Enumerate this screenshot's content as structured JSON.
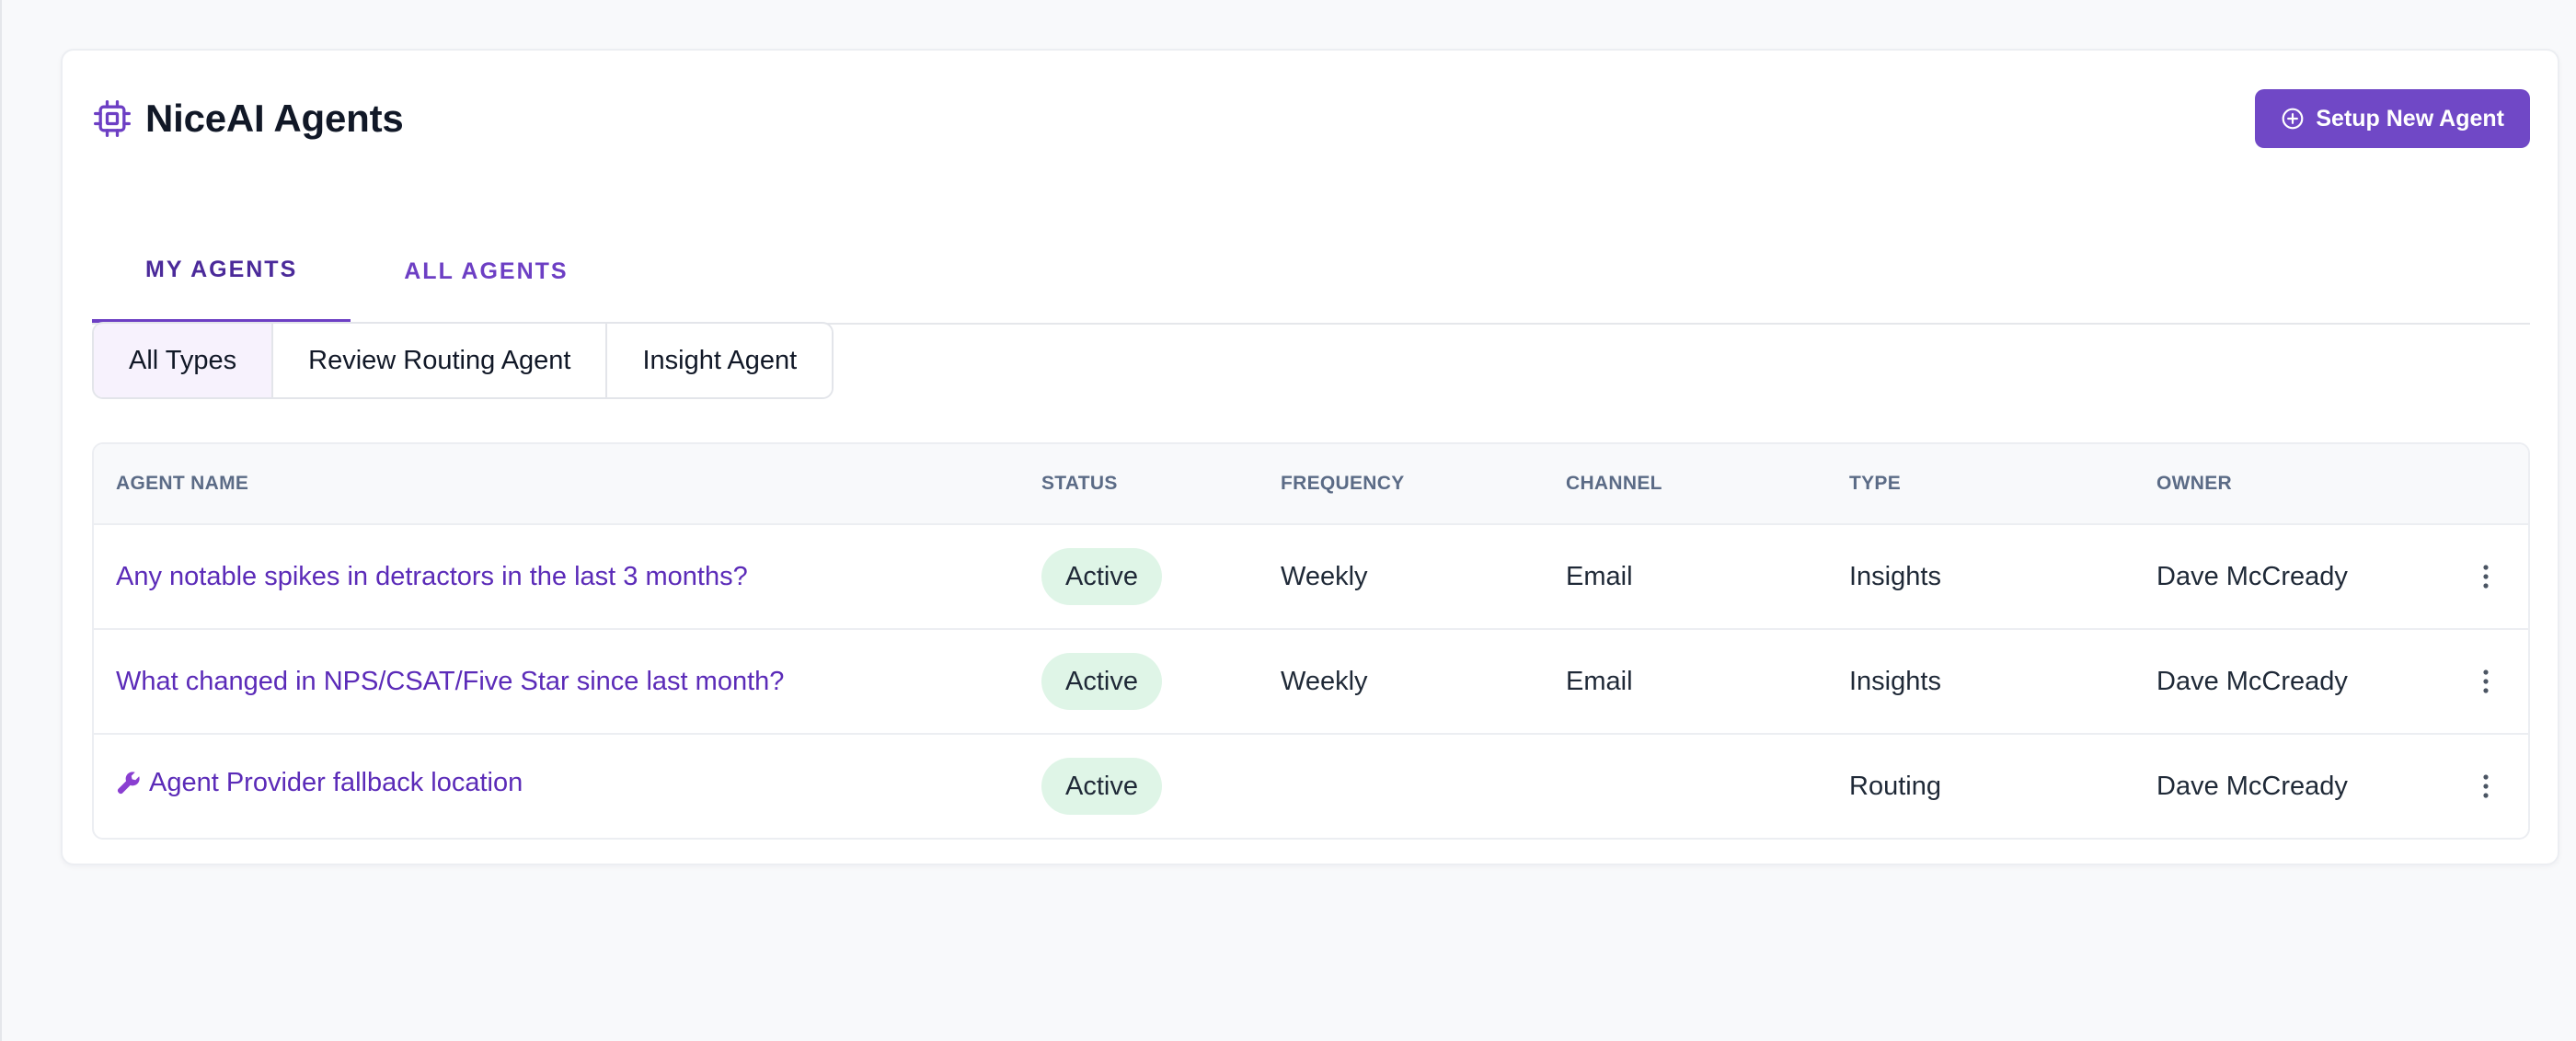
{
  "header": {
    "title": "NiceAI Agents",
    "icon": "chip-icon",
    "setup_button_label": "Setup New Agent"
  },
  "tabs": [
    {
      "label": "MY AGENTS",
      "active": true
    },
    {
      "label": "ALL AGENTS",
      "active": false
    }
  ],
  "filters": [
    {
      "label": "All Types",
      "selected": true
    },
    {
      "label": "Review Routing Agent",
      "selected": false
    },
    {
      "label": "Insight Agent",
      "selected": false
    }
  ],
  "table": {
    "columns": [
      "AGENT NAME",
      "STATUS",
      "FREQUENCY",
      "CHANNEL",
      "TYPE",
      "OWNER"
    ],
    "rows": [
      {
        "name": "Any notable spikes in detractors in the last 3 months?",
        "status": "Active",
        "frequency": "Weekly",
        "channel": "Email",
        "type": "Insights",
        "owner": "Dave McCready",
        "icon": ""
      },
      {
        "name": "What changed in NPS/CSAT/Five Star since last month?",
        "status": "Active",
        "frequency": "Weekly",
        "channel": "Email",
        "type": "Insights",
        "owner": "Dave McCready",
        "icon": ""
      },
      {
        "name": "Agent Provider fallback location",
        "status": "Active",
        "frequency": "",
        "channel": "",
        "type": "Routing",
        "owner": "Dave McCready",
        "icon": "wrench-icon"
      }
    ]
  },
  "colors": {
    "accent": "#7048c6",
    "link": "#5b2bb8",
    "status_active_bg": "#dff5e7"
  }
}
